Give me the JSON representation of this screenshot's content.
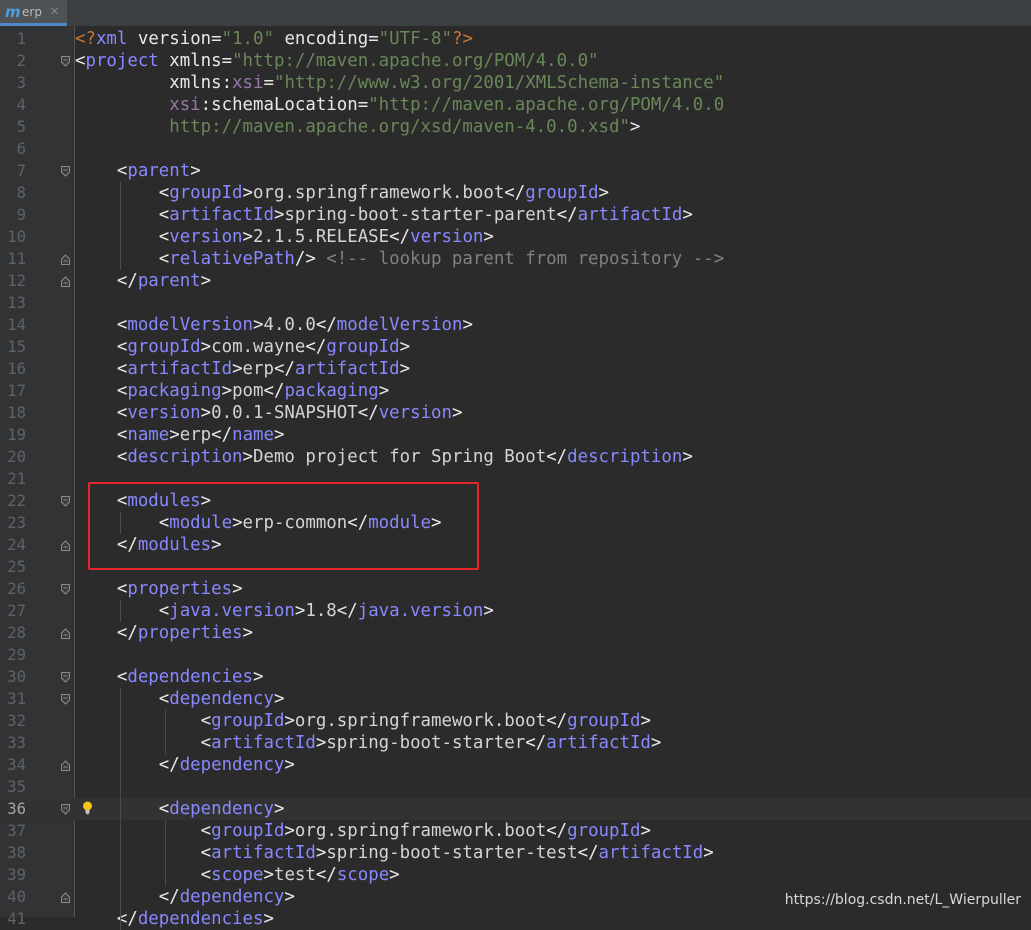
{
  "tab": {
    "icon": "maven-icon",
    "icon_glyph": "m",
    "label": "erp",
    "close": "✕"
  },
  "watermark": "https://blog.csdn.net/L_Wierpuller",
  "colors": {
    "background": "#2b2b2b",
    "gutter": "#313335",
    "tag": "#8888ff",
    "attr_value": "#6a8759",
    "comment": "#808080",
    "highlight_box": "#e5252a"
  },
  "current_line": 36,
  "lines": [
    {
      "n": "1",
      "tokens": [
        [
          "p",
          "<?"
        ],
        [
          "x",
          "xml"
        ],
        [
          "t",
          " version="
        ],
        [
          "v",
          "\"1.0\""
        ],
        [
          "t",
          " encoding="
        ],
        [
          "v",
          "\"UTF-8\""
        ],
        [
          "p",
          "?>"
        ]
      ]
    },
    {
      "n": "2",
      "tokens": [
        [
          "t",
          "<"
        ],
        [
          "x",
          "project"
        ],
        [
          "t",
          " xmlns="
        ],
        [
          "v",
          "\"http://maven.apache.org/POM/4.0.0\""
        ]
      ]
    },
    {
      "n": "3",
      "tokens": [
        [
          "t",
          "         xmlns:"
        ],
        [
          "n",
          "xsi"
        ],
        [
          "t",
          "="
        ],
        [
          "v",
          "\"http://www.w3.org/2001/XMLSchema-instance\""
        ]
      ]
    },
    {
      "n": "4",
      "tokens": [
        [
          "t",
          "         "
        ],
        [
          "n",
          "xsi"
        ],
        [
          "t",
          ":schemaLocation="
        ],
        [
          "v",
          "\"http://maven.apache.org/POM/4.0.0"
        ]
      ]
    },
    {
      "n": "5",
      "tokens": [
        [
          "v",
          "         http://maven.apache.org/xsd/maven-4.0.0.xsd\""
        ],
        [
          "t",
          ">"
        ]
      ]
    },
    {
      "n": "6",
      "tokens": []
    },
    {
      "n": "7",
      "tokens": [
        [
          "t",
          "    <"
        ],
        [
          "x",
          "parent"
        ],
        [
          "t",
          ">"
        ]
      ]
    },
    {
      "n": "8",
      "tokens": [
        [
          "t",
          "        <"
        ],
        [
          "x",
          "groupId"
        ],
        [
          "t",
          ">"
        ],
        [
          "d",
          "org.springframework.boot"
        ],
        [
          "t",
          "</"
        ],
        [
          "x",
          "groupId"
        ],
        [
          "t",
          ">"
        ]
      ]
    },
    {
      "n": "9",
      "tokens": [
        [
          "t",
          "        <"
        ],
        [
          "x",
          "artifactId"
        ],
        [
          "t",
          ">"
        ],
        [
          "d",
          "spring-boot-starter-parent"
        ],
        [
          "t",
          "</"
        ],
        [
          "x",
          "artifactId"
        ],
        [
          "t",
          ">"
        ]
      ]
    },
    {
      "n": "10",
      "tokens": [
        [
          "t",
          "        <"
        ],
        [
          "x",
          "version"
        ],
        [
          "t",
          ">"
        ],
        [
          "d",
          "2.1.5.RELEASE"
        ],
        [
          "t",
          "</"
        ],
        [
          "x",
          "version"
        ],
        [
          "t",
          ">"
        ]
      ]
    },
    {
      "n": "11",
      "tokens": [
        [
          "t",
          "        <"
        ],
        [
          "x",
          "relativePath"
        ],
        [
          "t",
          "/> "
        ],
        [
          "c",
          "<!-- lookup parent from repository -->"
        ]
      ]
    },
    {
      "n": "12",
      "tokens": [
        [
          "t",
          "    </"
        ],
        [
          "x",
          "parent"
        ],
        [
          "t",
          ">"
        ]
      ]
    },
    {
      "n": "13",
      "tokens": []
    },
    {
      "n": "14",
      "tokens": [
        [
          "t",
          "    <"
        ],
        [
          "x",
          "modelVersion"
        ],
        [
          "t",
          ">"
        ],
        [
          "d",
          "4.0.0"
        ],
        [
          "t",
          "</"
        ],
        [
          "x",
          "modelVersion"
        ],
        [
          "t",
          ">"
        ]
      ]
    },
    {
      "n": "15",
      "tokens": [
        [
          "t",
          "    <"
        ],
        [
          "x",
          "groupId"
        ],
        [
          "t",
          ">"
        ],
        [
          "d",
          "com.wayne"
        ],
        [
          "t",
          "</"
        ],
        [
          "x",
          "groupId"
        ],
        [
          "t",
          ">"
        ]
      ]
    },
    {
      "n": "16",
      "tokens": [
        [
          "t",
          "    <"
        ],
        [
          "x",
          "artifactId"
        ],
        [
          "t",
          ">"
        ],
        [
          "d",
          "erp"
        ],
        [
          "t",
          "</"
        ],
        [
          "x",
          "artifactId"
        ],
        [
          "t",
          ">"
        ]
      ]
    },
    {
      "n": "17",
      "tokens": [
        [
          "t",
          "    <"
        ],
        [
          "x",
          "packaging"
        ],
        [
          "t",
          ">"
        ],
        [
          "d",
          "pom"
        ],
        [
          "t",
          "</"
        ],
        [
          "x",
          "packaging"
        ],
        [
          "t",
          ">"
        ]
      ]
    },
    {
      "n": "18",
      "tokens": [
        [
          "t",
          "    <"
        ],
        [
          "x",
          "version"
        ],
        [
          "t",
          ">"
        ],
        [
          "d",
          "0.0.1-SNAPSHOT"
        ],
        [
          "t",
          "</"
        ],
        [
          "x",
          "version"
        ],
        [
          "t",
          ">"
        ]
      ]
    },
    {
      "n": "19",
      "tokens": [
        [
          "t",
          "    <"
        ],
        [
          "x",
          "name"
        ],
        [
          "t",
          ">"
        ],
        [
          "d",
          "erp"
        ],
        [
          "t",
          "</"
        ],
        [
          "x",
          "name"
        ],
        [
          "t",
          ">"
        ]
      ]
    },
    {
      "n": "20",
      "tokens": [
        [
          "t",
          "    <"
        ],
        [
          "x",
          "description"
        ],
        [
          "t",
          ">"
        ],
        [
          "d",
          "Demo project for Spring Boot"
        ],
        [
          "t",
          "</"
        ],
        [
          "x",
          "description"
        ],
        [
          "t",
          ">"
        ]
      ]
    },
    {
      "n": "21",
      "tokens": []
    },
    {
      "n": "22",
      "tokens": [
        [
          "t",
          "    <"
        ],
        [
          "x",
          "modules"
        ],
        [
          "t",
          ">"
        ]
      ]
    },
    {
      "n": "23",
      "tokens": [
        [
          "t",
          "        <"
        ],
        [
          "x",
          "module"
        ],
        [
          "t",
          ">"
        ],
        [
          "d",
          "erp-common"
        ],
        [
          "t",
          "</"
        ],
        [
          "x",
          "module"
        ],
        [
          "t",
          ">"
        ]
      ]
    },
    {
      "n": "24",
      "tokens": [
        [
          "t",
          "    </"
        ],
        [
          "x",
          "modules"
        ],
        [
          "t",
          ">"
        ]
      ]
    },
    {
      "n": "25",
      "tokens": []
    },
    {
      "n": "26",
      "tokens": [
        [
          "t",
          "    <"
        ],
        [
          "x",
          "properties"
        ],
        [
          "t",
          ">"
        ]
      ]
    },
    {
      "n": "27",
      "tokens": [
        [
          "t",
          "        <"
        ],
        [
          "x",
          "java.version"
        ],
        [
          "t",
          ">"
        ],
        [
          "d",
          "1.8"
        ],
        [
          "t",
          "</"
        ],
        [
          "x",
          "java.version"
        ],
        [
          "t",
          ">"
        ]
      ]
    },
    {
      "n": "28",
      "tokens": [
        [
          "t",
          "    </"
        ],
        [
          "x",
          "properties"
        ],
        [
          "t",
          ">"
        ]
      ]
    },
    {
      "n": "29",
      "tokens": []
    },
    {
      "n": "30",
      "tokens": [
        [
          "t",
          "    <"
        ],
        [
          "x",
          "dependencies"
        ],
        [
          "t",
          ">"
        ]
      ]
    },
    {
      "n": "31",
      "tokens": [
        [
          "t",
          "        <"
        ],
        [
          "x",
          "dependency"
        ],
        [
          "t",
          ">"
        ]
      ]
    },
    {
      "n": "32",
      "tokens": [
        [
          "t",
          "            <"
        ],
        [
          "x",
          "groupId"
        ],
        [
          "t",
          ">"
        ],
        [
          "d",
          "org.springframework.boot"
        ],
        [
          "t",
          "</"
        ],
        [
          "x",
          "groupId"
        ],
        [
          "t",
          ">"
        ]
      ]
    },
    {
      "n": "33",
      "tokens": [
        [
          "t",
          "            <"
        ],
        [
          "x",
          "artifactId"
        ],
        [
          "t",
          ">"
        ],
        [
          "d",
          "spring-boot-starter"
        ],
        [
          "t",
          "</"
        ],
        [
          "x",
          "artifactId"
        ],
        [
          "t",
          ">"
        ]
      ]
    },
    {
      "n": "34",
      "tokens": [
        [
          "t",
          "        </"
        ],
        [
          "x",
          "dependency"
        ],
        [
          "t",
          ">"
        ]
      ]
    },
    {
      "n": "35",
      "tokens": []
    },
    {
      "n": "36",
      "tokens": [
        [
          "t",
          "        <"
        ],
        [
          "x",
          "dependency"
        ],
        [
          "t",
          ">"
        ]
      ]
    },
    {
      "n": "37",
      "tokens": [
        [
          "t",
          "            <"
        ],
        [
          "x",
          "groupId"
        ],
        [
          "t",
          ">"
        ],
        [
          "d",
          "org.springframework.boot"
        ],
        [
          "t",
          "</"
        ],
        [
          "x",
          "groupId"
        ],
        [
          "t",
          ">"
        ]
      ]
    },
    {
      "n": "38",
      "tokens": [
        [
          "t",
          "            <"
        ],
        [
          "x",
          "artifactId"
        ],
        [
          "t",
          ">"
        ],
        [
          "d",
          "spring-boot-starter-test"
        ],
        [
          "t",
          "</"
        ],
        [
          "x",
          "artifactId"
        ],
        [
          "t",
          ">"
        ]
      ]
    },
    {
      "n": "39",
      "tokens": [
        [
          "t",
          "            <"
        ],
        [
          "x",
          "scope"
        ],
        [
          "t",
          ">"
        ],
        [
          "d",
          "test"
        ],
        [
          "t",
          "</"
        ],
        [
          "x",
          "scope"
        ],
        [
          "t",
          ">"
        ]
      ]
    },
    {
      "n": "40",
      "tokens": [
        [
          "t",
          "        </"
        ],
        [
          "x",
          "dependency"
        ],
        [
          "t",
          ">"
        ]
      ]
    },
    {
      "n": "41",
      "tokens": [
        [
          "t",
          "    </"
        ],
        [
          "x",
          "dependencies"
        ],
        [
          "t",
          ">"
        ]
      ]
    }
  ]
}
